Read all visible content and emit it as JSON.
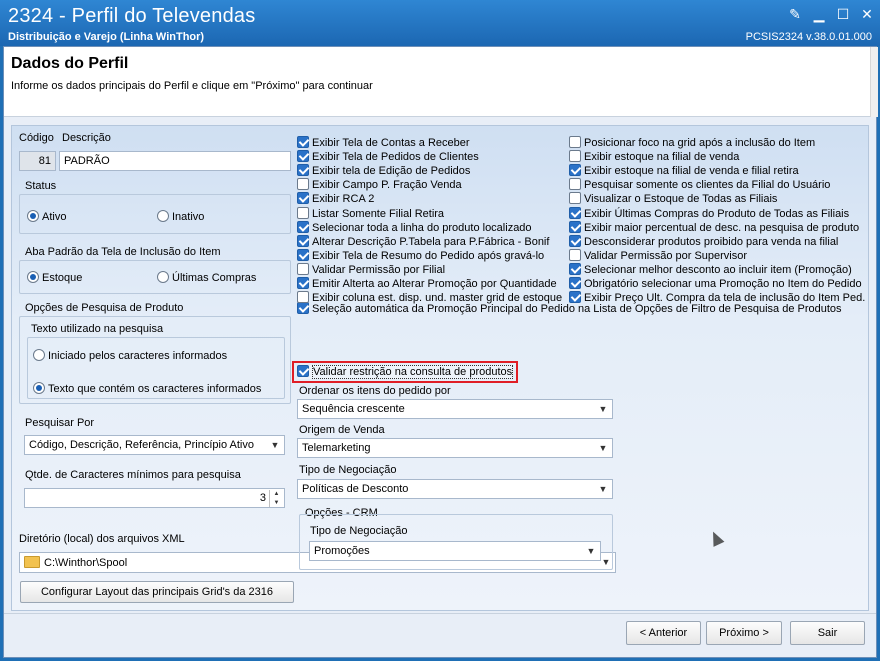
{
  "window": {
    "title": "2324 - Perfil do Televendas",
    "subtitle": "Distribuição e Varejo (Linha WinThor)",
    "version": "PCSIS2324  v.38.0.01.000"
  },
  "header": {
    "title": "Dados do Perfil",
    "instruction": "Informe os dados principais do Perfil e clique em \"Próximo\" para continuar"
  },
  "perfil": {
    "codigo_label": "Código",
    "descricao_label": "Descrição",
    "codigo_value": "81",
    "descricao_value": "PADRÃO"
  },
  "status": {
    "label": "Status",
    "options": [
      "Ativo",
      "Inativo"
    ],
    "selected": "Ativo"
  },
  "aba_padrao": {
    "label": "Aba Padrão da Tela de Inclusão do Item",
    "options": [
      "Estoque",
      "Últimas Compras"
    ],
    "selected": "Estoque"
  },
  "pesquisa": {
    "label": "Opções de Pesquisa de Produto",
    "texto_label": "Texto utilizado na pesquisa",
    "options": [
      "Iniciado pelos caracteres informados",
      "Texto que contém os caracteres informados"
    ],
    "selected": "Texto que contém os caracteres informados",
    "pesquisar_por_label": "Pesquisar Por",
    "pesquisar_por_value": "Código, Descrição, Referência, Princípio Ativo",
    "qtde_label": "Qtde. de Caracteres mínimos para pesquisa",
    "qtde_value": "3"
  },
  "diretorio": {
    "label": "Diretório (local) dos arquivos XML",
    "value": "C:\\Winthor\\Spool"
  },
  "config_button": "Configurar Layout das principais Grid's da 2316",
  "checks_left": [
    {
      "label": "Exibir Tela de Contas a Receber",
      "checked": true
    },
    {
      "label": "Exibir Tela de Pedidos de Clientes",
      "checked": true
    },
    {
      "label": "Exibir tela de Edição de Pedidos",
      "checked": true
    },
    {
      "label": "Exibir Campo P. Fração Venda",
      "checked": false
    },
    {
      "label": "Exibir RCA 2",
      "checked": true
    },
    {
      "label": "Listar Somente Filial Retira",
      "checked": false
    },
    {
      "label": "Selecionar toda a linha do produto localizado",
      "checked": true
    },
    {
      "label": "Alterar Descrição P.Tabela para P.Fábrica - Bonif",
      "checked": true
    },
    {
      "label": "Exibir Tela de Resumo do Pedido após gravá-lo",
      "checked": true
    },
    {
      "label": "Validar Permissão por Filial",
      "checked": false
    },
    {
      "label": "Emitir Alterta ao Alterar Promoção por Quantidade",
      "checked": true
    },
    {
      "label": "Exibir coluna est. disp. und. master grid de estoque",
      "checked": false
    }
  ],
  "check_wide": {
    "label": "Seleção automática da Promoção Principal do Pedido na Lista de Opções de Filtro de Pesquisa de Produtos",
    "checked": true
  },
  "check_highlight": {
    "label": "Validar restrição na consulta de produtos",
    "checked": true
  },
  "checks_right": [
    {
      "label": "Posicionar foco na grid após a inclusão do Item",
      "checked": false
    },
    {
      "label": "Exibir estoque na filial de venda",
      "checked": false
    },
    {
      "label": "Exibir estoque na filial de venda e filial retira",
      "checked": true
    },
    {
      "label": "Pesquisar somente os clientes da Filial do Usuário",
      "checked": false
    },
    {
      "label": "Visualizar o Estoque de Todas as Filiais",
      "checked": false
    },
    {
      "label": "Exibir Últimas Compras do Produto de Todas as Filiais",
      "checked": true
    },
    {
      "label": "Exibir maior percentual de desc. na pesquisa de produto",
      "checked": true
    },
    {
      "label": "Desconsiderar produtos proibido para venda na filial",
      "checked": true
    },
    {
      "label": "Validar Permissão por Supervisor",
      "checked": false
    },
    {
      "label": "Selecionar melhor desconto ao incluir item (Promoção)",
      "checked": true
    },
    {
      "label": "Obrigatório selecionar uma Promoção no Item do Pedido",
      "checked": true
    },
    {
      "label": "Exibir Preço Ult. Compra da tela de inclusão do Item Ped.",
      "checked": true
    }
  ],
  "ordenar": {
    "label": "Ordenar os itens do pedido por",
    "value": "Sequência crescente"
  },
  "origem": {
    "label": "Origem de Venda",
    "value": "Telemarketing"
  },
  "negociacao": {
    "label": "Tipo de Negociação",
    "value": "Políticas de Desconto"
  },
  "crm": {
    "label": "Opções - CRM",
    "negociacao_label": "Tipo de Negociação",
    "negociacao_value": "Promoções"
  },
  "footer": {
    "anterior": "< Anterior",
    "proximo": "Próximo >",
    "sair": "Sair"
  }
}
